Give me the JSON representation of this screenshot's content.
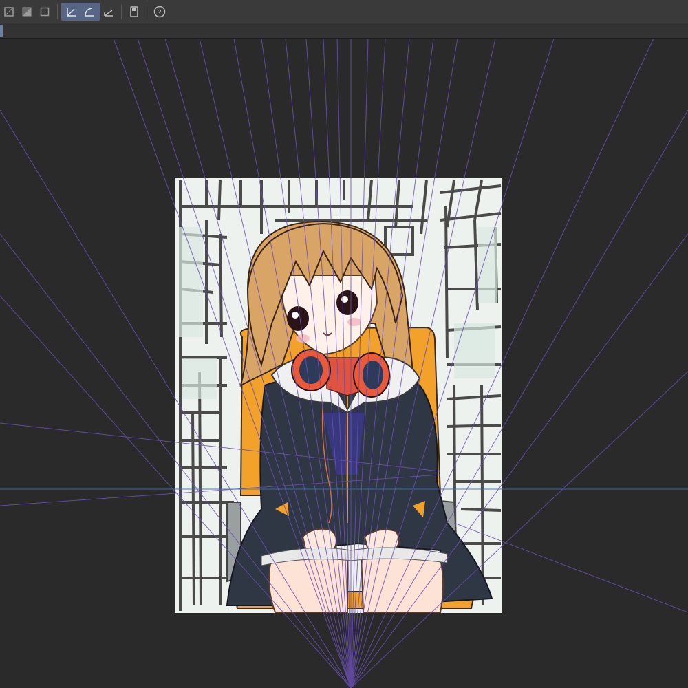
{
  "app": {
    "toolbar": {
      "buttons": [
        {
          "name": "mask-out-icon"
        },
        {
          "name": "mask-in-icon"
        },
        {
          "name": "show-area-icon"
        },
        {
          "name": "ruler-snap-icon"
        },
        {
          "name": "special-ruler-snap-icon"
        },
        {
          "name": "perspective-ruler-icon"
        },
        {
          "name": "device-icon"
        },
        {
          "name": "help-icon"
        }
      ]
    }
  },
  "canvas": {
    "description_colors": {
      "background_sky": "#eef2ee",
      "hair": "#d9a567",
      "coat": "#2f3644",
      "chair": "#f2a22a",
      "scarf": "#e0533f",
      "headphones_red": "#e85a3a",
      "perspective_lines": "#6a4fb0",
      "horizon_line": "#3b6fb8"
    }
  }
}
